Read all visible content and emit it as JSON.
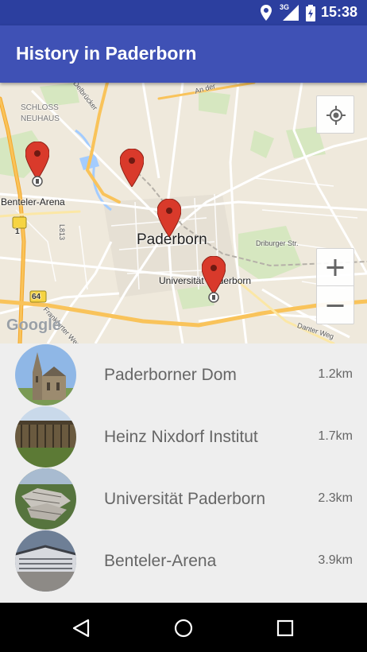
{
  "status_bar": {
    "time": "15:38",
    "network": "3G",
    "icons": [
      "location-icon",
      "cell-signal-icon",
      "battery-charging-icon"
    ]
  },
  "app_bar": {
    "title": "History in Paderborn"
  },
  "map": {
    "city_label": "Paderborn",
    "labels": {
      "schloss": "SCHLOSS",
      "neuhaus": "NEUHAUS",
      "benteler": "Benteler-Arena",
      "universitaet": "Universität Paderborn",
      "driburger": "Driburger Str.",
      "frankfurter": "Frankfurter Weg",
      "dantewe": "Danter Weg",
      "delbrueck": "Delbrücker",
      "road_1": "1",
      "road_64": "64",
      "l813": "L813",
      "an_der": "An der"
    },
    "attribution": "Google",
    "controls": {
      "my_location": "my-location-icon",
      "zoom_in": "+",
      "zoom_out": "−"
    },
    "colors": {
      "water": "#a3ccff",
      "park": "#cde4b2",
      "major_road": "#f8c557",
      "road": "#ffffff"
    }
  },
  "places": [
    {
      "name": "Paderborner Dom",
      "distance": "1.2km"
    },
    {
      "name": "Heinz Nixdorf Institut",
      "distance": "1.7km"
    },
    {
      "name": "Universität Paderborn",
      "distance": "2.3km"
    },
    {
      "name": "Benteler-Arena",
      "distance": "3.9km"
    }
  ],
  "nav_bar": {
    "icons": [
      "back-icon",
      "home-icon",
      "recents-icon"
    ]
  },
  "colors": {
    "primary": "#3f51b5",
    "primary_dark": "#2c3f9f",
    "accent_pin": "#d93a2b"
  }
}
